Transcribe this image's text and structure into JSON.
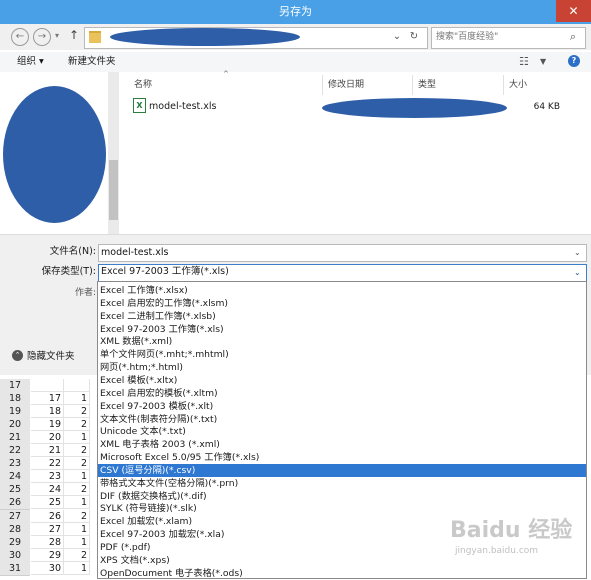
{
  "window": {
    "title": "另存为",
    "close": "✕"
  },
  "address": {
    "nav_back": "←",
    "nav_forward": "→",
    "nav_up": "↑",
    "refresh": "↻",
    "search_placeholder": "搜索\"百度经验\""
  },
  "toolbar": {
    "organize": "组织 ▾",
    "new_folder": "新建文件夹",
    "view": "☷",
    "view_arrow": "▼",
    "help": "?"
  },
  "columns": {
    "name": "名称",
    "date": "修改日期",
    "type": "类型",
    "size": "大小"
  },
  "files": [
    {
      "name": "model-test.xls",
      "size": "64 KB"
    }
  ],
  "form": {
    "filename_label": "文件名(N):",
    "filename_value": "model-test.xls",
    "type_label": "保存类型(T):",
    "type_value": "Excel 97-2003 工作簿(*.xls)",
    "author_label": "作者:",
    "hide_folders": "隐藏文件夹",
    "hide_icon": "⌃"
  },
  "type_options": [
    "Excel 工作簿(*.xlsx)",
    "Excel 启用宏的工作簿(*.xlsm)",
    "Excel 二进制工作簿(*.xlsb)",
    "Excel 97-2003 工作簿(*.xls)",
    "XML 数据(*.xml)",
    "单个文件网页(*.mht;*.mhtml)",
    "网页(*.htm;*.html)",
    "Excel 模板(*.xltx)",
    "Excel 启用宏的模板(*.xltm)",
    "Excel 97-2003 模板(*.xlt)",
    "文本文件(制表符分隔)(*.txt)",
    "Unicode 文本(*.txt)",
    "XML 电子表格 2003 (*.xml)",
    "Microsoft Excel 5.0/95 工作簿(*.xls)",
    "CSV (逗号分隔)(*.csv)",
    "带格式文本文件(空格分隔)(*.prn)",
    "DIF (数据交换格式)(*.dif)",
    "SYLK (符号链接)(*.slk)",
    "Excel 加载宏(*.xlam)",
    "Excel 97-2003 加载宏(*.xla)",
    "PDF (*.pdf)",
    "XPS 文档(*.xps)",
    "OpenDocument 电子表格(*.ods)"
  ],
  "selected_option_index": 14,
  "sheet_rows": [
    {
      "row": "17",
      "b": "",
      "c": ""
    },
    {
      "row": "18",
      "b": "17",
      "c": "1"
    },
    {
      "row": "19",
      "b": "18",
      "c": "2"
    },
    {
      "row": "20",
      "b": "19",
      "c": "2"
    },
    {
      "row": "21",
      "b": "20",
      "c": "1"
    },
    {
      "row": "22",
      "b": "21",
      "c": "2"
    },
    {
      "row": "23",
      "b": "22",
      "c": "2"
    },
    {
      "row": "24",
      "b": "23",
      "c": "1"
    },
    {
      "row": "25",
      "b": "24",
      "c": "2"
    },
    {
      "row": "26",
      "b": "25",
      "c": "1"
    },
    {
      "row": "27",
      "b": "26",
      "c": "2"
    },
    {
      "row": "28",
      "b": "27",
      "c": "1"
    },
    {
      "row": "29",
      "b": "28",
      "c": "1"
    },
    {
      "row": "30",
      "b": "29",
      "c": "2"
    },
    {
      "row": "31",
      "b": "30",
      "c": "1"
    }
  ],
  "watermark": {
    "text": "Baidu 经验",
    "sub": "jingyan.baidu.com"
  },
  "colors": {
    "titlebar": "#4aa0e6",
    "close": "#c94335",
    "selection": "#2e78d2",
    "redaction": "#2f5ea8"
  }
}
